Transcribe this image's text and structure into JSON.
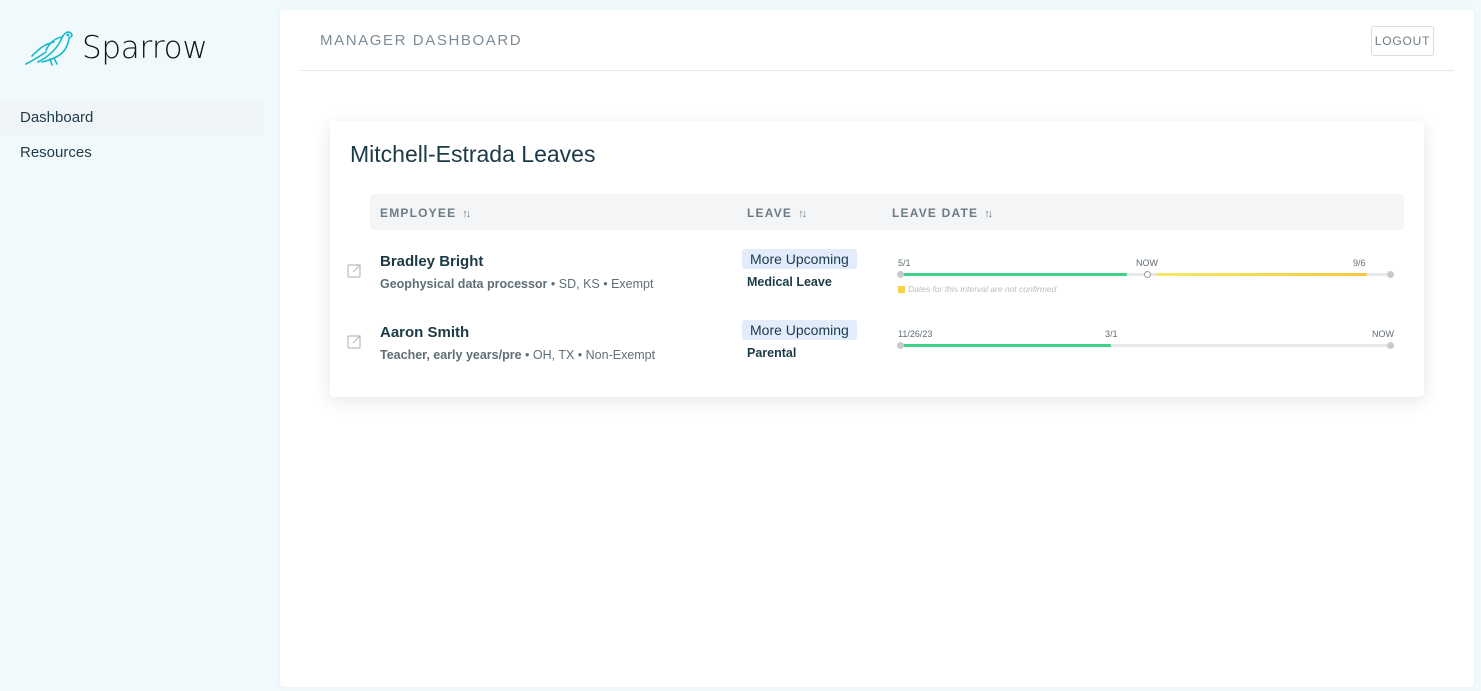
{
  "app": {
    "name": "Sparrow"
  },
  "sidebar": {
    "items": [
      {
        "label": "Dashboard",
        "active": true
      },
      {
        "label": "Resources",
        "active": false
      }
    ]
  },
  "header": {
    "title": "MANAGER DASHBOARD",
    "logout_label": "LOGOUT"
  },
  "card": {
    "title": "Mitchell-Estrada Leaves",
    "columns": {
      "employee": "EMPLOYEE",
      "leave": "LEAVE",
      "leave_date": "LEAVE DATE"
    },
    "rows": [
      {
        "name": "Bradley Bright",
        "role": "Geophysical data processor",
        "meta": " • SD, KS • Exempt",
        "badge": "More Upcoming",
        "leave_type": "Medical Leave",
        "timeline": {
          "start_label": "5/1",
          "mid_label": "NOW",
          "end_label": "9/6",
          "note": "Dates for this interval are not confirmed",
          "confirmed_fraction": 0.46,
          "now_fraction": 0.5,
          "unconfirmed_end_fraction": 0.95
        }
      },
      {
        "name": "Aaron Smith",
        "role": "Teacher, early years/pre",
        "meta": " • OH, TX • Non-Exempt",
        "badge": "More Upcoming",
        "leave_type": "Parental",
        "timeline": {
          "start_label": "11/26/23",
          "mid_label": "3/1",
          "end_label": "NOW",
          "confirmed_fraction": 0.43
        }
      }
    ]
  },
  "colors": {
    "brand": "#18b7c9",
    "confirmed": "#3fd08c",
    "unconfirmed": "#f6c844",
    "badge_bg": "#e3ecfb"
  }
}
